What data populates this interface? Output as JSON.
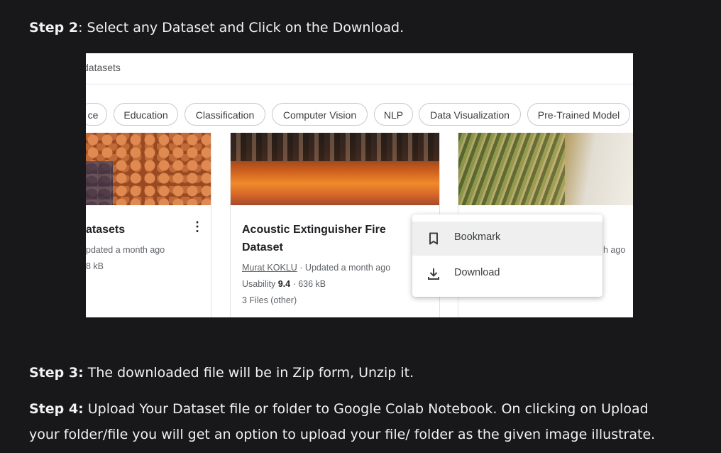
{
  "article": {
    "step2": {
      "label": "Step 2",
      "text": ": Select any Dataset and Click on the Download."
    },
    "step3": {
      "label": "Step 3:",
      "text": " The downloaded file will be in Zip form, Unzip it."
    },
    "step4": {
      "label": "Step 4:",
      "text_line1": " Upload Your Dataset file or folder to Google Colab Notebook. On clicking on Upload",
      "text_line2": "your folder/file you will get an option to upload your file/ folder as the given image illustrate."
    }
  },
  "screenshot": {
    "breadcrumb": "datasets",
    "chips": [
      "ce",
      "Education",
      "Classification",
      "Computer Vision",
      "NLP",
      "Data Visualization",
      "Pre-Trained Model"
    ],
    "cards": [
      {
        "title": "atasets",
        "meta1": "pdated a month ago",
        "meta2": "8 kB",
        "more": "⋮"
      },
      {
        "title_line1": "Acoustic Extinguisher Fire",
        "title_line2": "Dataset",
        "author": "Murat KOKLU",
        "updated": " · Updated a month ago",
        "usability_label": "Usability ",
        "usability_value": "9.4",
        "size": " · 636 kB",
        "files": "3 Files (other)"
      },
      {
        "meta1": "h ago"
      }
    ],
    "menu": {
      "items": [
        {
          "label": "Bookmark",
          "icon": "bookmark-icon"
        },
        {
          "label": "Download",
          "icon": "download-icon"
        }
      ]
    }
  }
}
